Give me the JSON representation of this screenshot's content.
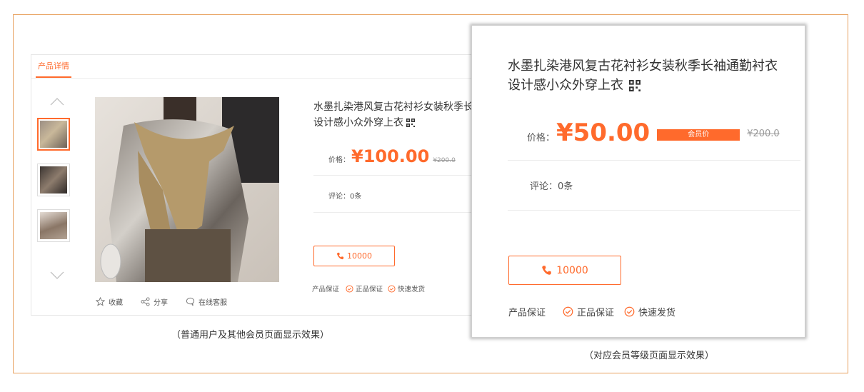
{
  "product": {
    "title_line1": "水墨扎染港风复古花衬衫女装秋季长袖通勤衬衣",
    "title_line2": "设计感小众外穿上衣",
    "title_short_line1": "水墨扎染港风复古花衬衫女装秋季长",
    "tab_label": "产品详情",
    "price_label": "价格：",
    "normal_price": "¥100.00",
    "member_price": "¥50.00",
    "original_price": "¥200.0",
    "member_badge": "会员价",
    "comments": "评论：0条",
    "phone": "10000",
    "guarantee_label": "产品保证",
    "guarantee_items": [
      "正品保证",
      "快速发货"
    ],
    "actions": [
      "收藏",
      "分享",
      "在线客服"
    ]
  },
  "captions": {
    "left": "（普通用户及其他会员页面显示效果）",
    "right": "（对应会员等级页面显示效果）"
  },
  "colors": {
    "accent": "#ff6a2c",
    "frame": "#e8a15f"
  },
  "icons": [
    "qr-code-icon",
    "phone-icon",
    "check-circle-icon",
    "star-icon",
    "share-icon",
    "chat-icon",
    "chevron-up-icon",
    "chevron-down-icon"
  ]
}
